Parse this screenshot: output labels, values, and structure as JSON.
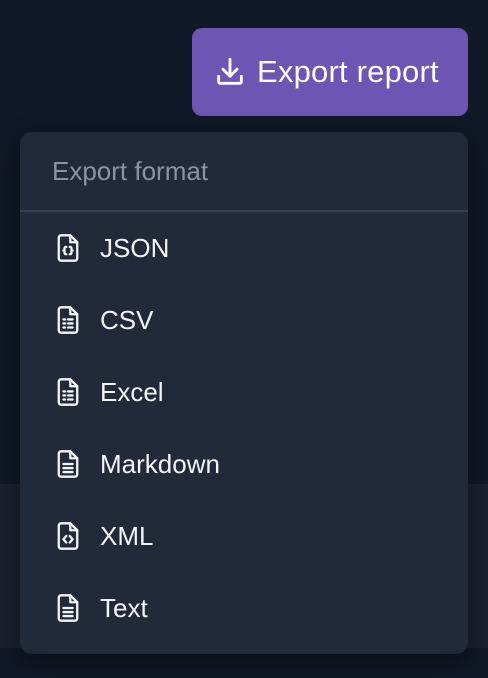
{
  "export_button": {
    "label": "Export report",
    "icon": "download-icon",
    "background": "#6c55b3"
  },
  "menu": {
    "header": "Export format",
    "items": [
      {
        "label": "JSON",
        "icon": "file-code-icon"
      },
      {
        "label": "CSV",
        "icon": "file-table-icon"
      },
      {
        "label": "Excel",
        "icon": "file-table-icon"
      },
      {
        "label": "Markdown",
        "icon": "file-text-icon"
      },
      {
        "label": "XML",
        "icon": "file-code-icon"
      },
      {
        "label": "Text",
        "icon": "file-text-icon"
      }
    ]
  },
  "colors": {
    "page_background": "#111827",
    "menu_background": "#222938",
    "menu_header_text": "#8b94a3",
    "menu_item_text": "#f3f4f6"
  }
}
